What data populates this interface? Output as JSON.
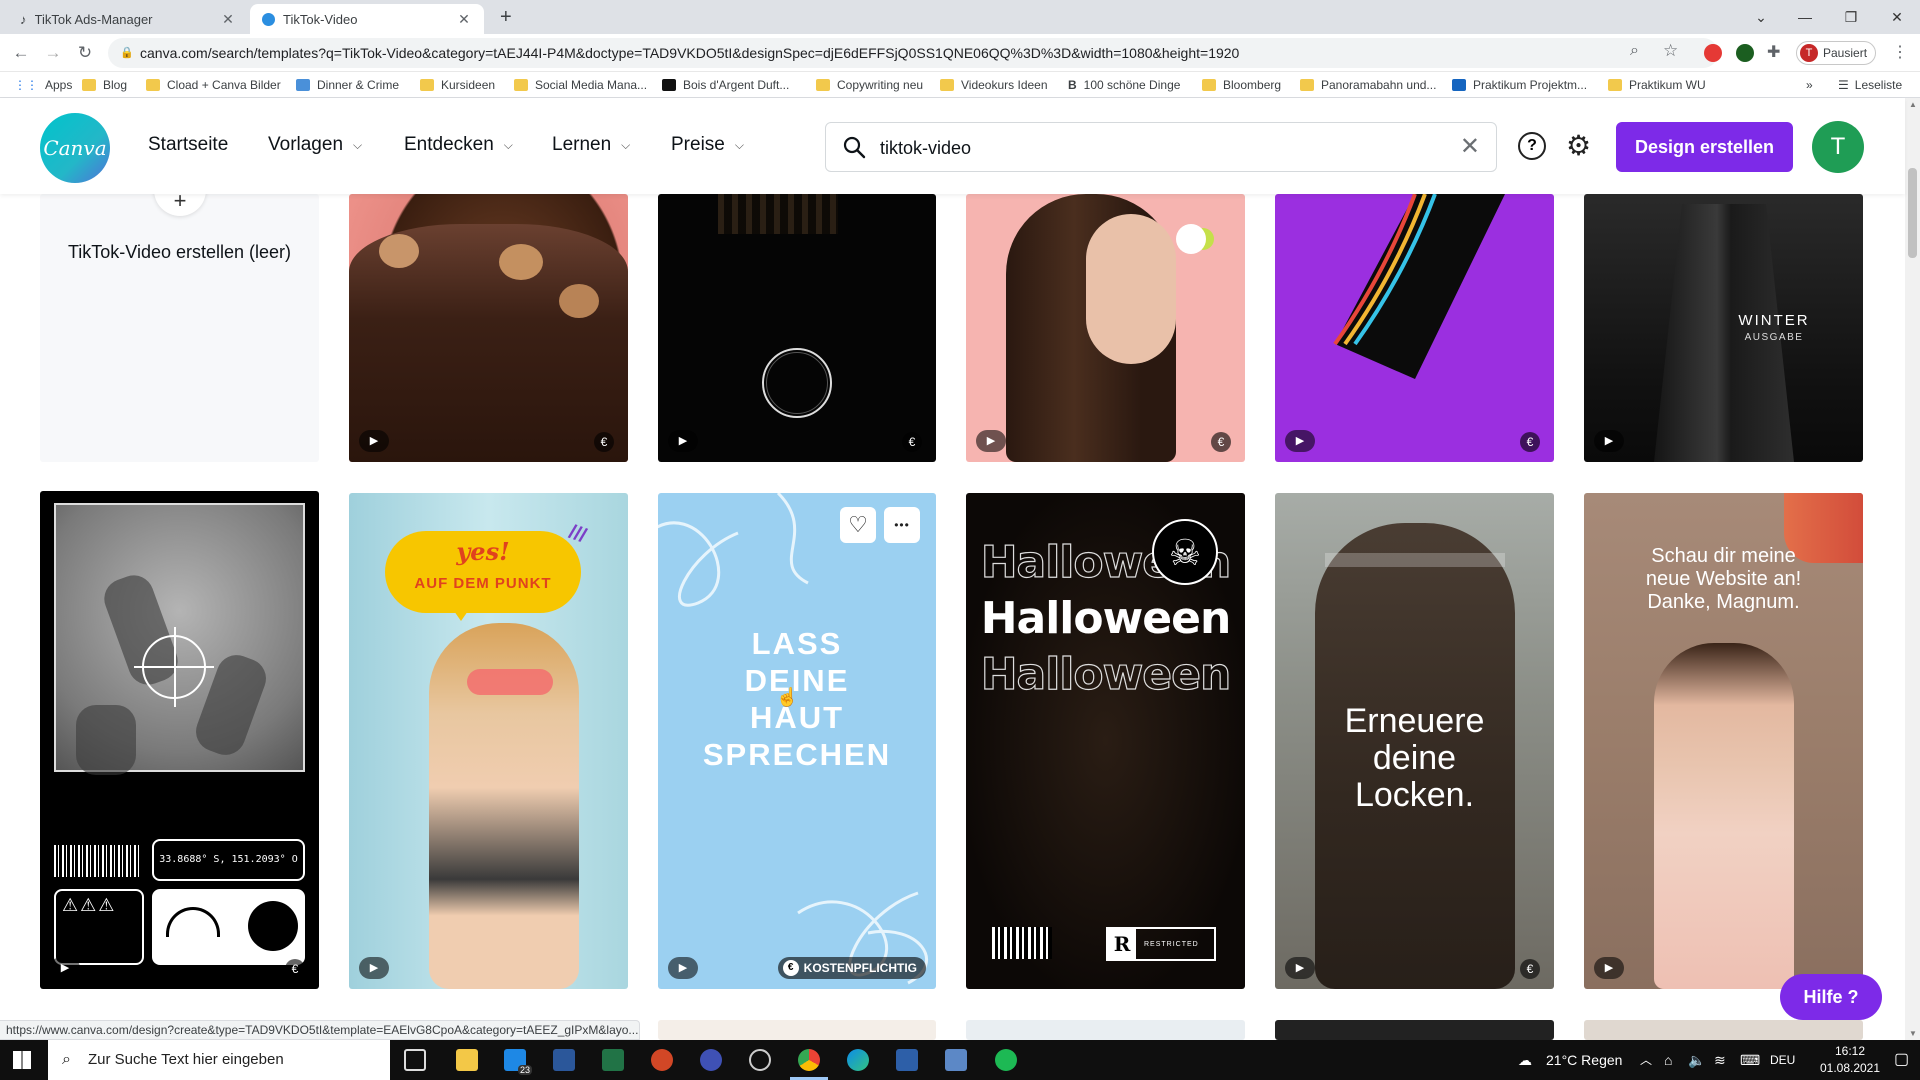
{
  "browser": {
    "tabs": [
      {
        "title": "TikTok Ads-Manager"
      },
      {
        "title": "TikTok-Video"
      }
    ],
    "new_tab": "+",
    "url": "canva.com/search/templates?q=TikTok-Video&category=tAEJ44I-P4M&doctype=TAD9VKDO5tI&designSpec=djE6dEFFSjQ0SS1QNE06QQ%3D%3D&width=1080&height=1920",
    "profile_status": "Pausiert",
    "profile_initial": "T",
    "bookmarks": [
      "Apps",
      "Blog",
      "Cload + Canva Bilder",
      "Dinner & Crime",
      "Kursideen",
      "Social Media Mana...",
      "Bois d'Argent Duft...",
      "Copywriting neu",
      "Videokurs Ideen",
      "100 schöne Dinge",
      "Bloomberg",
      "Panoramabahn und...",
      "Praktikum Projektm...",
      "Praktikum WU"
    ],
    "more_bookmarks": "»",
    "reading_list": "Leseliste",
    "status_url": "https://www.canva.com/design?create&type=TAD9VKDO5tI&template=EAElvG8CpoA&category=tAEEZ_gIPxM&layo..."
  },
  "canva": {
    "logo": "Canva",
    "nav": [
      "Startseite",
      "Vorlagen",
      "Entdecken",
      "Lernen",
      "Preise"
    ],
    "search_value": "tiktok-video",
    "help_glyph": "?",
    "design_button": "Design erstellen",
    "user_initial": "T",
    "help_button": "Hilfe ?"
  },
  "templates": {
    "blank_label": "TikTok-Video erstellen (leer)",
    "winter_title": "WINTER",
    "winter_sub": "AUSGABE",
    "coords": "33.8688° S, 151.2093° O",
    "yes_text": "yes!",
    "punkt_text": "AUF DEM PUNKT",
    "haut_lines": [
      "LASS",
      "DEINE",
      "HAUT",
      "SPRECHEN"
    ],
    "kostenpflichtig": "KOSTENPFLICHTIG",
    "halloween": "Halloween",
    "restricted_letter": "R",
    "restricted_text": "RESTRICTED",
    "locken_lines": [
      "Erneuere",
      "deine",
      "Locken."
    ],
    "website_lines": [
      "Schau dir meine",
      "neue Website an!",
      "Danke, Magnum."
    ],
    "play_glyph": "▶",
    "euro_glyph": "€",
    "more_glyph": "•••",
    "heart_glyph": "♡"
  },
  "taskbar": {
    "search_placeholder": "Zur Suche Text hier eingeben",
    "weather": "21°C  Regen",
    "language": "DEU",
    "time": "16:12",
    "date": "01.08.2021",
    "mail_badge": "23"
  },
  "colors": {
    "canva_purple": "#7d2ae8",
    "canva_teal": "#00c4cc",
    "avatar_green": "#1f9d55"
  }
}
